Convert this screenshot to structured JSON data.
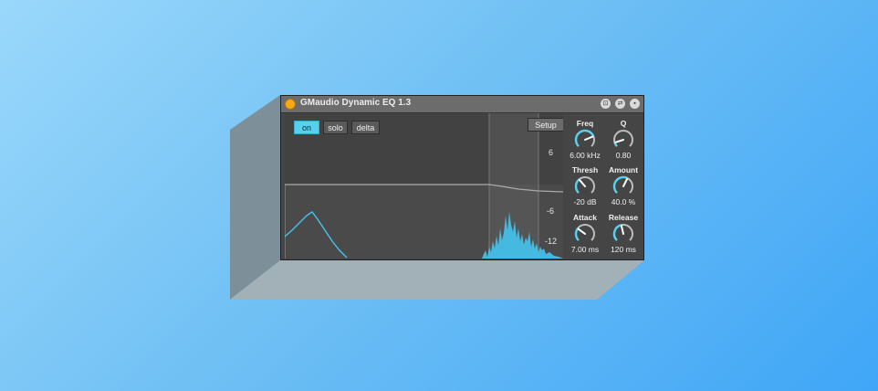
{
  "device": {
    "title": "GMaudio Dynamic EQ 1.3",
    "power_on": true,
    "accent_color": "#5ad0f0",
    "power_color": "#f7a91a"
  },
  "titlebar_buttons": [
    {
      "icon": "link-icon",
      "glyph": "⊡"
    },
    {
      "icon": "swap-icon",
      "glyph": "⇄"
    },
    {
      "icon": "save-icon",
      "glyph": "▪"
    }
  ],
  "display": {
    "mode_buttons": [
      {
        "label": "on",
        "active": true
      },
      {
        "label": "solo",
        "active": false
      },
      {
        "label": "delta",
        "active": false
      }
    ],
    "setup_label": "Setup",
    "db_labels": [
      "6",
      "-6",
      "-12"
    ]
  },
  "knobs": [
    {
      "label": "Freq",
      "value": "6.00 kHz",
      "level": 0.75
    },
    {
      "label": "Q",
      "value": "0.80",
      "level": 0.1
    },
    {
      "label": "Thresh",
      "value": "-20 dB",
      "level": 0.35
    },
    {
      "label": "Amount",
      "value": "40.0 %",
      "level": 0.6
    },
    {
      "label": "Attack",
      "value": "7.00 ms",
      "level": 0.3
    },
    {
      "label": "Release",
      "value": "120 ms",
      "level": 0.45
    }
  ]
}
